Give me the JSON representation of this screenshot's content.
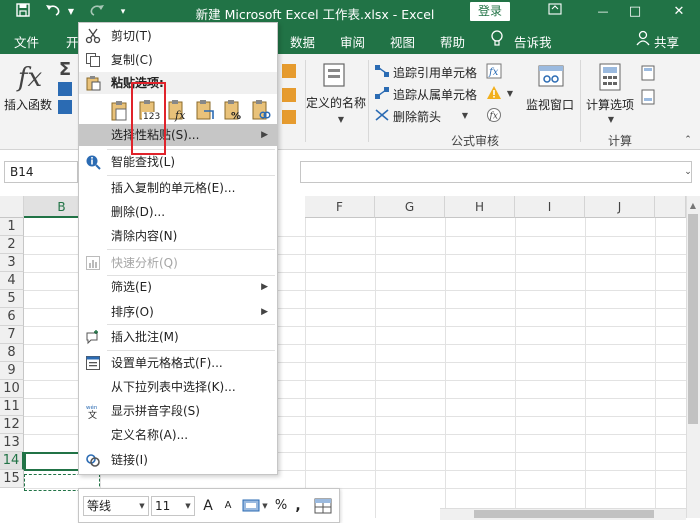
{
  "titlebar": {
    "title": "新建 Microsoft Excel 工作表.xlsx  -  Excel",
    "login": "登录",
    "minimize": "—",
    "restore": "□",
    "close": "✕"
  },
  "tabs": [
    "文件",
    "开",
    "数据",
    "审阅",
    "视图",
    "帮助",
    "告诉我"
  ],
  "share": "共享",
  "ribbon": {
    "insert_function": "插入函数",
    "define_name": "定义的名称",
    "trace_precedents": "追踪引用单元格",
    "trace_dependents": "追踪从属单元格",
    "remove_arrows": "删除箭头",
    "watch_window": "监视窗口",
    "calc_options": "计算选项",
    "group_audit": "公式审核",
    "group_calc": "计算"
  },
  "namebox": "B14",
  "columns": [
    "B",
    "F",
    "G",
    "H",
    "I",
    "J"
  ],
  "rows": [
    "1",
    "2",
    "3",
    "4",
    "5",
    "6",
    "7",
    "8",
    "9",
    "10",
    "11",
    "12",
    "13",
    "14",
    "15"
  ],
  "menu": {
    "cut": "剪切(T)",
    "copy": "复制(C)",
    "paste_options": "粘贴选项:",
    "paste_special": "选择性粘贴(S)...",
    "smart_lookup": "智能查找(L)",
    "insert_copied": "插入复制的单元格(E)...",
    "delete": "删除(D)...",
    "clear": "清除内容(N)",
    "quick_analysis": "快速分析(Q)",
    "filter": "筛选(E)",
    "sort": "排序(O)",
    "insert_comment": "插入批注(M)",
    "format_cells": "设置单元格格式(F)...",
    "pick_from_list": "从下拉列表中选择(K)...",
    "phonetic": "显示拼音字段(S)",
    "define_name": "定义名称(A)...",
    "link": "链接(I)",
    "paste_values_badge": "123"
  },
  "mini": {
    "font": "等线",
    "size": "11",
    "grow": "A",
    "shrink": "A",
    "percent": "%",
    "comma": ","
  },
  "colors": {
    "excel_green": "#217346",
    "highlight_red": "#e0232b",
    "menu_hover": "#c6c6c6"
  }
}
